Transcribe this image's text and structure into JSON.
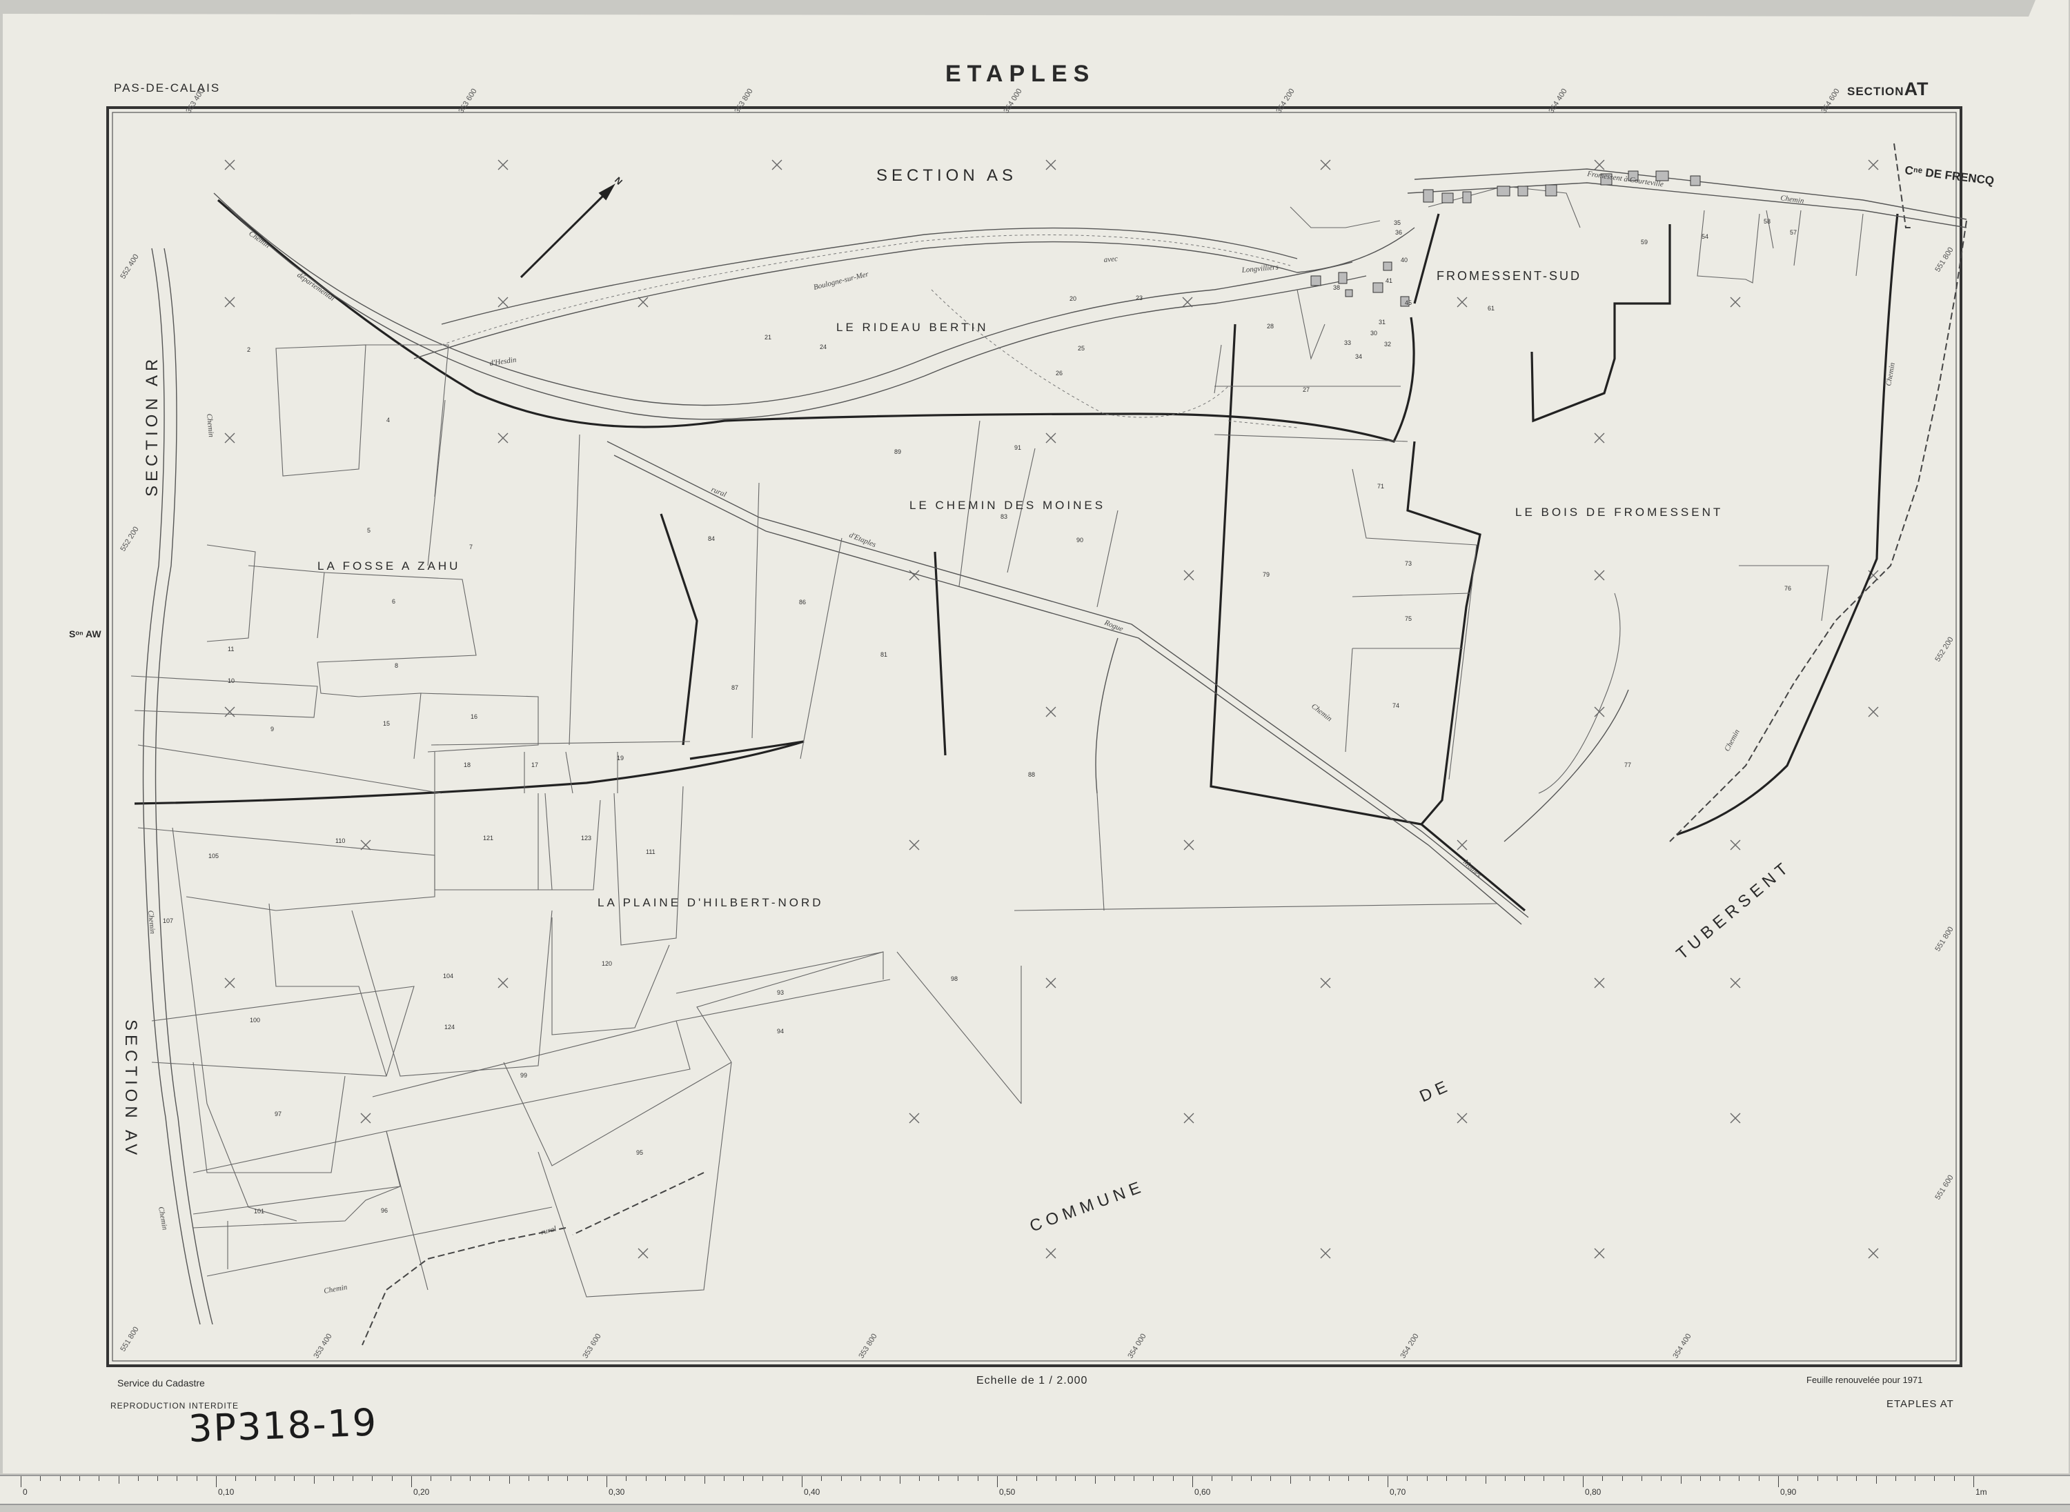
{
  "header": {
    "title": "ETAPLES",
    "department": "PAS-DE-CALAIS",
    "section_prefix": "SECTION",
    "section_code": "AT"
  },
  "footer": {
    "service": "Service du Cadastre",
    "reproduction": "REPRODUCTION  INTERDITE",
    "scale": "Echelle de 1 / 2.000",
    "renewal": "Feuille renouvelée pour 1971",
    "sheet_ref": "ETAPLES  AT",
    "archive_ref": "3P318-19"
  },
  "colors": {
    "paper": "#ecebe4",
    "ink": "#2a2a2a",
    "background": "#c9c9c4",
    "ruler_red": "#c0392b"
  },
  "map_labels": {
    "section_as": "SECTION          AS",
    "section_ar": "SECTION   AR",
    "section_av": "SECTION   AV",
    "section_aw": "Sᵒⁿ AW",
    "frencq": "Cⁿᵉ DE FRENCQ",
    "fromessent_sud": "FROMESSENT-SUD",
    "rideau_bertin": "LE RIDEAU BERTIN",
    "chemin_moines": "LE CHEMIN DES MOINES",
    "bois_fromessent": "LE BOIS DE FROMESSENT",
    "fosse_zahu": "LA FOSSE A ZAHU",
    "plaine_hilbert": "LA PLAINE D'HILBERT-NORD",
    "commune": "COMMUNE",
    "de": "DE",
    "tubersent": "TUBERSENT",
    "north": "N"
  },
  "parcels": [
    {
      "id": "2",
      "label": "2"
    },
    {
      "id": "4",
      "label": "4"
    },
    {
      "id": "5",
      "label": "5"
    },
    {
      "id": "6",
      "label": "6"
    },
    {
      "id": "7",
      "label": "7"
    },
    {
      "id": "8",
      "label": "8"
    },
    {
      "id": "9",
      "label": "9"
    },
    {
      "id": "10",
      "label": "10"
    },
    {
      "id": "11",
      "label": "11"
    },
    {
      "id": "15",
      "label": "15"
    },
    {
      "id": "16",
      "label": "16"
    },
    {
      "id": "17",
      "label": "17"
    },
    {
      "id": "18",
      "label": "18"
    },
    {
      "id": "19",
      "label": "19"
    },
    {
      "id": "20",
      "label": "20"
    },
    {
      "id": "21",
      "label": "21"
    },
    {
      "id": "23",
      "label": "23"
    },
    {
      "id": "24",
      "label": "24"
    },
    {
      "id": "25",
      "label": "25"
    },
    {
      "id": "26",
      "label": "26"
    },
    {
      "id": "27",
      "label": "27"
    },
    {
      "id": "28",
      "label": "28"
    },
    {
      "id": "30",
      "label": "30"
    },
    {
      "id": "31",
      "label": "31"
    },
    {
      "id": "32",
      "label": "32"
    },
    {
      "id": "33",
      "label": "33"
    },
    {
      "id": "34",
      "label": "34"
    },
    {
      "id": "35",
      "label": "35"
    },
    {
      "id": "36",
      "label": "36"
    },
    {
      "id": "38",
      "label": "38"
    },
    {
      "id": "40",
      "label": "40"
    },
    {
      "id": "41",
      "label": "41"
    },
    {
      "id": "45",
      "label": "45"
    },
    {
      "id": "54",
      "label": "54"
    },
    {
      "id": "57",
      "label": "57"
    },
    {
      "id": "58",
      "label": "58"
    },
    {
      "id": "59",
      "label": "59"
    },
    {
      "id": "61",
      "label": "61"
    },
    {
      "id": "71",
      "label": "71"
    },
    {
      "id": "73",
      "label": "73"
    },
    {
      "id": "74",
      "label": "74"
    },
    {
      "id": "75",
      "label": "75"
    },
    {
      "id": "76",
      "label": "76"
    },
    {
      "id": "77",
      "label": "77"
    },
    {
      "id": "79",
      "label": "79"
    },
    {
      "id": "81",
      "label": "81"
    },
    {
      "id": "83",
      "label": "83"
    },
    {
      "id": "84",
      "label": "84"
    },
    {
      "id": "86",
      "label": "86"
    },
    {
      "id": "87",
      "label": "87"
    },
    {
      "id": "88",
      "label": "88"
    },
    {
      "id": "89",
      "label": "89"
    },
    {
      "id": "90",
      "label": "90"
    },
    {
      "id": "91",
      "label": "91"
    },
    {
      "id": "93",
      "label": "93"
    },
    {
      "id": "94",
      "label": "94"
    },
    {
      "id": "95",
      "label": "95"
    },
    {
      "id": "96",
      "label": "96"
    },
    {
      "id": "97",
      "label": "97"
    },
    {
      "id": "98",
      "label": "98"
    },
    {
      "id": "99",
      "label": "99"
    },
    {
      "id": "100",
      "label": "100"
    },
    {
      "id": "101",
      "label": "101"
    },
    {
      "id": "104",
      "label": "104"
    },
    {
      "id": "105",
      "label": "105"
    },
    {
      "id": "107",
      "label": "107"
    },
    {
      "id": "110",
      "label": "110"
    },
    {
      "id": "111",
      "label": "111"
    },
    {
      "id": "120",
      "label": "120"
    },
    {
      "id": "121",
      "label": "121"
    },
    {
      "id": "123",
      "label": "123"
    },
    {
      "id": "124",
      "label": "124"
    }
  ],
  "ruler": {
    "major_labels": [
      "0",
      "0,10",
      "0,20",
      "0,30",
      "0,40",
      "0,50",
      "0,60",
      "0,70",
      "0,80",
      "0,90",
      "1m"
    ]
  }
}
